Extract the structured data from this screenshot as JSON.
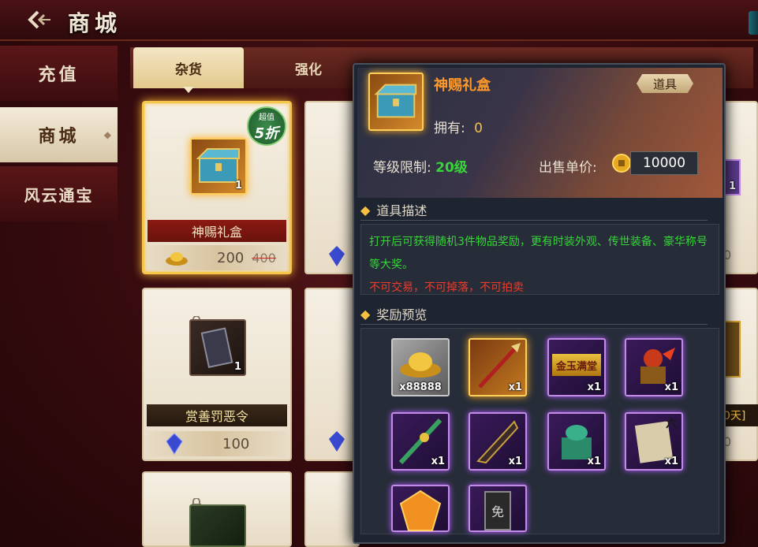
{
  "header": {
    "title": "商城"
  },
  "sidebar": {
    "items": [
      {
        "label": "充值"
      },
      {
        "label": "商城"
      },
      {
        "label": "风云通宝"
      }
    ]
  },
  "tabs": [
    {
      "label": "杂货"
    },
    {
      "label": "强化"
    }
  ],
  "products": [
    {
      "name": "神赐礼盒",
      "qty": "1",
      "price": "200",
      "original_price": "400",
      "badge_top": "超值",
      "badge_main": "5折",
      "currency": "gold-ingot"
    },
    {
      "name": "赏善罚恶令",
      "qty": "1",
      "price": "100",
      "currency": "blue-crystal"
    }
  ],
  "partial_card_texts": {
    "right_tag": "0天]",
    "right_qty": "1",
    "right_price_digit": "0"
  },
  "popup": {
    "item_name": "神赐礼盒",
    "type_tag": "道具",
    "owned_label": "拥有:",
    "owned_value": "0",
    "level_label": "等级限制:",
    "level_value": "20级",
    "price_label": "出售单价:",
    "price_value": "10000",
    "desc_title": "道具描述",
    "desc_line1": "打开后可获得随机3件物品奖励，更有时装外观、传世装备、豪华称号等大奖。",
    "desc_line2": "不可交易，不可掉落，不可拍卖",
    "reward_title": "奖励预览",
    "rewards": [
      {
        "icon": "gold-ingot-icon",
        "qty": "x88888",
        "rarity": "gray"
      },
      {
        "icon": "red-spear-icon",
        "qty": "x1",
        "rarity": "gold"
      },
      {
        "icon": "title-plaque-icon",
        "qty": "x1",
        "rarity": "purple",
        "label": "金玉满堂"
      },
      {
        "icon": "lion-mount-icon",
        "qty": "x1",
        "rarity": "purple"
      },
      {
        "icon": "jade-sword-icon",
        "qty": "x1",
        "rarity": "purple"
      },
      {
        "icon": "dark-blade-icon",
        "qty": "x1",
        "rarity": "purple"
      },
      {
        "icon": "jade-seal-icon",
        "qty": "x1",
        "rarity": "purple"
      },
      {
        "icon": "scroll-icon",
        "qty": "x1",
        "rarity": "purple",
        "label": "六"
      },
      {
        "icon": "amber-gem-icon",
        "qty": "",
        "rarity": "purple"
      },
      {
        "icon": "exempt-token-icon",
        "qty": "",
        "rarity": "purple",
        "label": "免"
      }
    ]
  },
  "colors": {
    "green_text": "#37d43a",
    "red_text": "#f03a2a",
    "orange_title": "#ff9a2a",
    "gold_border": "#f6c64a"
  }
}
